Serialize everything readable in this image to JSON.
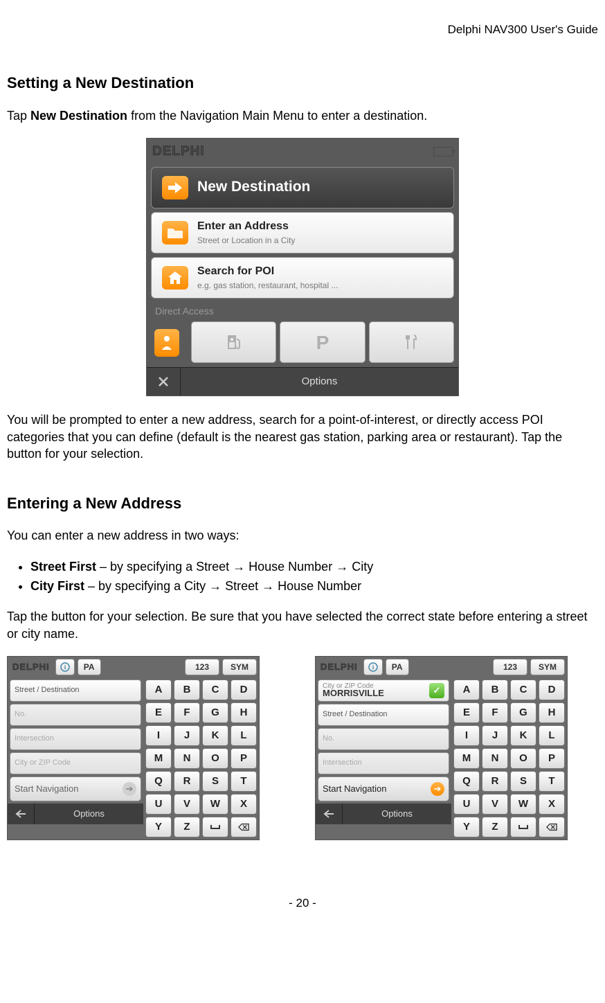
{
  "header": "Delphi NAV300 User's Guide",
  "section1_title": "Setting a New Destination",
  "p1_pre": "Tap ",
  "p1_bold": "New Destination",
  "p1_post": " from the Navigation Main Menu to enter a destination.",
  "nav_menu": {
    "logo": "DELPHI",
    "item_selected": "New Destination",
    "item2_title": "Enter an Address",
    "item2_sub": "Street or Location in a City",
    "item3_title": "Search for POI",
    "item3_sub": "e.g. gas station, restaurant, hospital ...",
    "direct_label": "Direct Access",
    "options": "Options"
  },
  "p2": "You will be prompted to enter a new address, search for a point-of-interest, or directly access POI categories that you can define (default is the nearest gas station, parking area or restaurant).  Tap the button for your selection.",
  "section2_title": "Entering a New Address",
  "p3": "You can enter a new address in two ways:",
  "bullet1_bold": "Street First",
  "bullet1_rest": " – by specifying a Street → House Number → City",
  "bullet2_bold": "City First",
  "bullet2_rest": " – by specifying a City → Street → House Number",
  "p4": "Tap the button for your selection.  Be sure that you have selected the correct state before entering a street or city name.",
  "kb": {
    "logo": "DELPHI",
    "state": "PA",
    "num": "123",
    "sym": "SYM",
    "keys": [
      "A",
      "B",
      "C",
      "D",
      "E",
      "F",
      "G",
      "H",
      "I",
      "J",
      "K",
      "L",
      "M",
      "N",
      "O",
      "P",
      "Q",
      "R",
      "S",
      "T",
      "U",
      "V",
      "W",
      "X",
      "Y",
      "Z"
    ],
    "left1": {
      "f1": "Street / Destination",
      "f2": "No.",
      "f3": "Intersection",
      "f4": "City or ZIP Code",
      "start": "Start Navigation",
      "options": "Options"
    },
    "left2": {
      "f1_label": "City or ZIP Code",
      "f1_val": "MORRISVILLE",
      "f2": "Street / Destination",
      "f3": "No.",
      "f4": "Intersection",
      "start": "Start Navigation",
      "options": "Options"
    }
  },
  "footer": "- 20 -"
}
